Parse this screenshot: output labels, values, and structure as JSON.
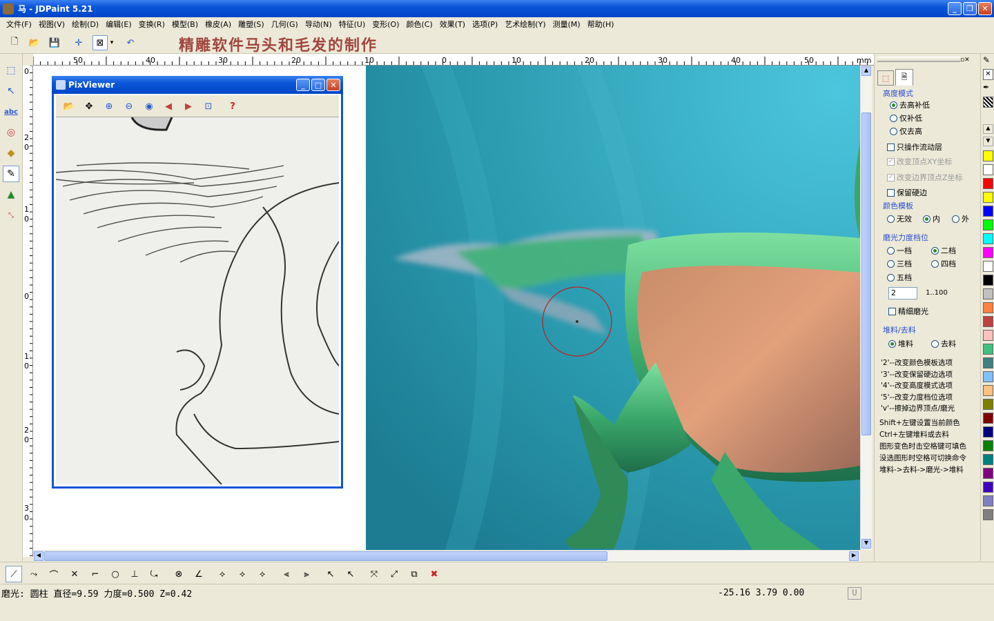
{
  "window": {
    "title": "马 - JDPaint 5.21"
  },
  "menu": [
    "文件(F)",
    "视图(V)",
    "绘制(D)",
    "编辑(E)",
    "变换(R)",
    "模型(B)",
    "橡皮(A)",
    "雕塑(S)",
    "几何(G)",
    "导动(N)",
    "特征(U)",
    "变形(O)",
    "颜色(C)",
    "效果(T)",
    "选项(P)",
    "艺术绘制(Y)",
    "测量(M)",
    "帮助(H)"
  ],
  "banner": "精雕软件马头和毛发的制作",
  "ruler": {
    "h_labels": [
      "50",
      "40",
      "30",
      "20",
      "10",
      "0",
      "10",
      "20",
      "30",
      "40",
      "50",
      "mm"
    ],
    "v_labels": [
      "0",
      "2\n0",
      "1\n0",
      "0",
      "1\n0",
      "2\n0",
      "3\n0"
    ]
  },
  "pixviewer": {
    "title": "PixViewer"
  },
  "panel": {
    "height_mode": {
      "label": "高度模式",
      "options": [
        "去高补低",
        "仅补低",
        "仅去高"
      ],
      "selected": 0
    },
    "flow_only": "只操作流动层",
    "change_xy": "改变顶点XY坐标",
    "change_z": "改变边界顶点Z坐标",
    "keep_edge": "保留硬边",
    "color_template": {
      "label": "颜色模板",
      "options": [
        "无效",
        "内",
        "外"
      ],
      "selected": 1
    },
    "polish_level": {
      "label": "磨光力度档位",
      "options": [
        "一档",
        "二档",
        "三档",
        "四档",
        "五档"
      ],
      "selected": 1,
      "value": "2",
      "range": "1..100"
    },
    "fine_polish": "精细磨光",
    "fill_remove": {
      "label": "堆料/去料",
      "options": [
        "堆料",
        "去料"
      ],
      "selected": 0
    },
    "hints": [
      "'2'--改变颜色模板选项",
      "'3'--改变保留硬边选项",
      "'4'--改变高度模式选项",
      "'5'--改变力度档位选项",
      "'v'--擦掉边界顶点/磨光"
    ],
    "hints2": [
      "Shift+左键设置当前颜色",
      "Ctrl+左键堆料或去料",
      "图形变色时击空格键可填色",
      "没选图形时空格可切换命令",
      "堆料->去料->磨光->堆料"
    ]
  },
  "palette": [
    "#ffff00",
    "#ffffff",
    "#ff0000",
    "#ffff00",
    "#0000ff",
    "#00ff00",
    "#00ffff",
    "#ff00ff",
    "#ffffff",
    "#000000",
    "#c0c0c0",
    "#ff8040",
    "#c04040",
    "#ffc0c0",
    "#40c080",
    "#408080",
    "#80c0ff",
    "#ffc080",
    "#808000",
    "#800000",
    "#000080",
    "#008000",
    "#008080",
    "#800080",
    "#4000c0",
    "#8080c0",
    "#808080"
  ],
  "status": {
    "left": "磨光: 圆柱   直径=9.59   力度=0.500   Z=0.42",
    "coords": "-25.16 3.79 0.00",
    "mode": "U"
  }
}
